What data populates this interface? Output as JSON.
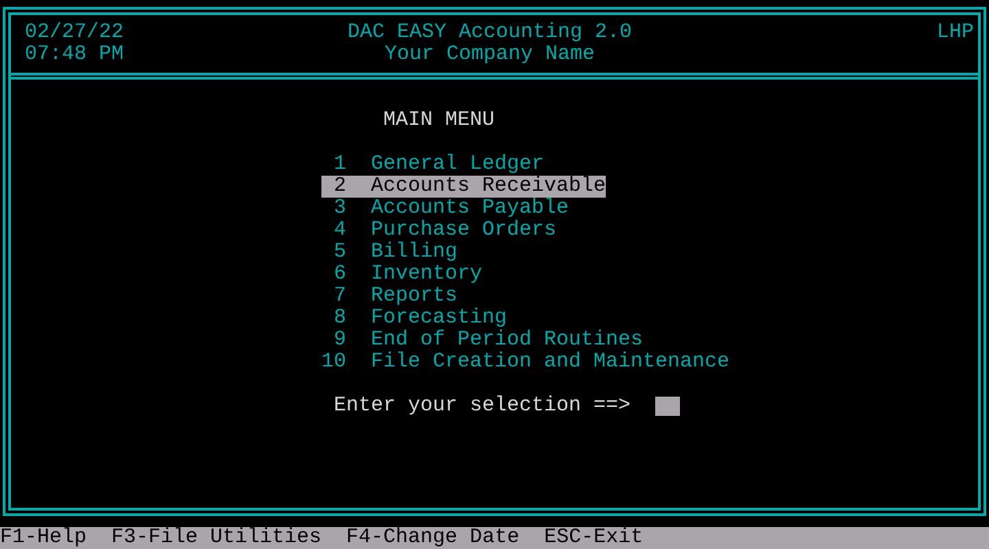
{
  "header": {
    "date": "02/27/22",
    "time": "07:48 PM",
    "title": "DAC EASY Accounting 2.0",
    "company": "Your Company Name",
    "user": "LHP"
  },
  "menu": {
    "title": "MAIN MENU",
    "items": [
      {
        "number": "1",
        "label": "General Ledger",
        "selected": false
      },
      {
        "number": "2",
        "label": "Accounts Receivable",
        "selected": true
      },
      {
        "number": "3",
        "label": "Accounts Payable",
        "selected": false
      },
      {
        "number": "4",
        "label": "Purchase Orders",
        "selected": false
      },
      {
        "number": "5",
        "label": "Billing",
        "selected": false
      },
      {
        "number": "6",
        "label": "Inventory",
        "selected": false
      },
      {
        "number": "7",
        "label": "Reports",
        "selected": false
      },
      {
        "number": "8",
        "label": "Forecasting",
        "selected": false
      },
      {
        "number": "9",
        "label": "End of Period Routines",
        "selected": false
      },
      {
        "number": "10",
        "label": "File Creation and Maintenance",
        "selected": false
      }
    ]
  },
  "prompt": {
    "label": "Enter your selection ==>"
  },
  "status_bar": [
    "F1-Help",
    "F3-File Utilities",
    "F4-Change Date",
    "ESC-Exit"
  ]
}
